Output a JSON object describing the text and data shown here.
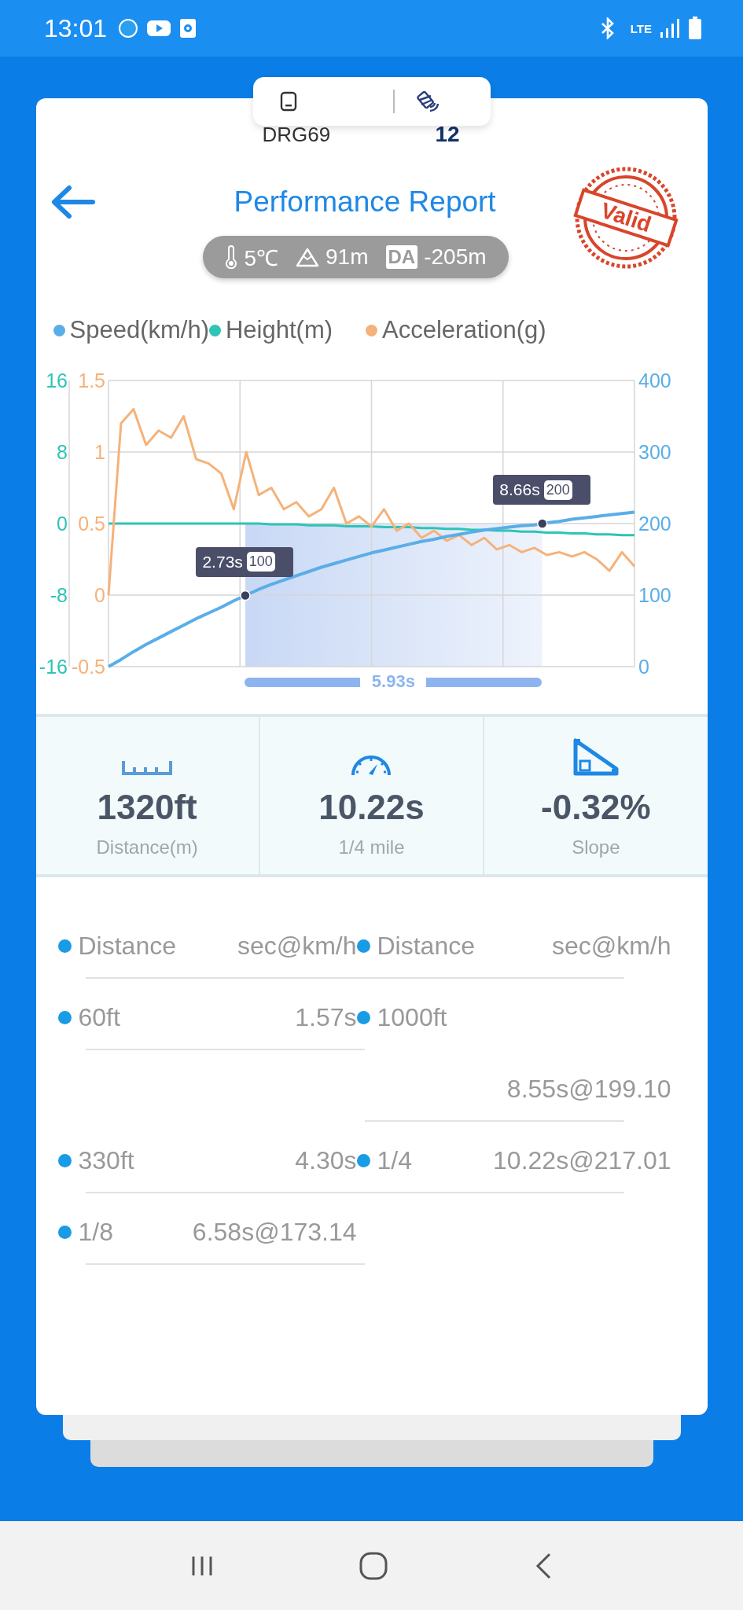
{
  "status_bar": {
    "time": "13:01",
    "network": "LTE"
  },
  "device": {
    "name": "DRG69",
    "satellites": "12"
  },
  "header": {
    "title": "Performance Report",
    "stamp": "Valid"
  },
  "conditions": {
    "temperature": "5℃",
    "altitude": "91m",
    "da_label": "DA",
    "density_altitude": "-205m"
  },
  "chart": {
    "range_label": "5.93s",
    "markers": [
      {
        "time": "2.73s",
        "speed": "100"
      },
      {
        "time": "8.66s",
        "speed": "200"
      }
    ],
    "panels": [
      {
        "chart_data": {
          "type": "line",
          "ylim": [
            0,
            400
          ],
          "yticks": [
            0,
            100,
            200,
            300,
            400
          ],
          "categories": [
            null,
            null,
            null,
            null,
            null,
            null,
            null,
            null,
            null,
            null,
            null,
            null,
            null,
            null,
            null,
            null,
            null,
            null,
            null,
            null,
            null,
            null,
            null,
            null,
            null,
            null,
            null,
            null,
            null,
            null,
            null,
            null,
            null,
            null,
            null,
            null,
            null,
            null,
            null,
            null,
            null,
            null,
            null
          ],
          "series": [
            {
              "name": "Speed(km/h)",
              "color": "#5aaee8",
              "values": [
                0,
                10,
                21,
                31,
                40,
                49,
                58,
                67,
                75,
                83,
                92,
                100,
                108,
                115,
                121,
                127,
                133,
                139,
                144,
                149,
                154,
                159,
                163,
                167,
                171,
                175,
                178,
                182,
                185,
                188,
                191,
                193,
                195,
                197,
                198,
                201,
                203,
                206,
                208,
                210,
                212,
                214,
                216
              ]
            }
          ]
        }
      },
      {
        "chart_data": {
          "type": "line",
          "ylim": [
            -16,
            16
          ],
          "yticks": [
            -16,
            -8,
            0,
            8,
            16
          ],
          "categories": [
            null,
            null,
            null,
            null,
            null,
            null,
            null,
            null,
            null,
            null,
            null,
            null,
            null,
            null,
            null,
            null,
            null,
            null,
            null,
            null,
            null,
            null,
            null,
            null,
            null,
            null,
            null,
            null,
            null,
            null,
            null,
            null,
            null,
            null,
            null,
            null,
            null,
            null,
            null,
            null,
            null,
            null,
            null
          ],
          "series": [
            {
              "name": "Height(m)",
              "color": "#2ec4b6",
              "values": [
                0,
                0,
                0,
                0,
                0,
                0,
                0,
                0,
                0,
                0,
                0,
                0,
                0,
                -0.1,
                -0.1,
                -0.1,
                -0.2,
                -0.2,
                -0.2,
                -0.3,
                -0.3,
                -0.3,
                -0.4,
                -0.4,
                -0.4,
                -0.5,
                -0.5,
                -0.6,
                -0.6,
                -0.7,
                -0.7,
                -0.8,
                -0.8,
                -0.9,
                -0.9,
                -1.0,
                -1.0,
                -1.1,
                -1.1,
                -1.2,
                -1.2,
                -1.3,
                -1.3
              ]
            }
          ]
        }
      },
      {
        "chart_data": {
          "type": "line",
          "ylim": [
            -0.5,
            1.5
          ],
          "yticks": [
            -0.5,
            0,
            0.5,
            1,
            1.5
          ],
          "categories": [
            null,
            null,
            null,
            null,
            null,
            null,
            null,
            null,
            null,
            null,
            null,
            null,
            null,
            null,
            null,
            null,
            null,
            null,
            null,
            null,
            null,
            null,
            null,
            null,
            null,
            null,
            null,
            null,
            null,
            null,
            null,
            null,
            null,
            null,
            null,
            null,
            null,
            null,
            null,
            null,
            null,
            null,
            null
          ],
          "series": [
            {
              "name": "Acceleration(g)",
              "color": "#f5b27a",
              "values": [
                0,
                1.2,
                1.3,
                1.05,
                1.15,
                1.1,
                1.25,
                0.95,
                0.92,
                0.85,
                0.6,
                1.0,
                0.7,
                0.75,
                0.6,
                0.65,
                0.55,
                0.6,
                0.75,
                0.5,
                0.55,
                0.48,
                0.6,
                0.45,
                0.5,
                0.4,
                0.45,
                0.38,
                0.42,
                0.35,
                0.4,
                0.32,
                0.35,
                0.3,
                0.33,
                0.28,
                0.3,
                0.27,
                0.3,
                0.25,
                0.17,
                0.3,
                0.2
              ]
            }
          ]
        }
      }
    ]
  },
  "stats": [
    {
      "kind": "distance",
      "value": "1320ft",
      "label": "Distance(m)"
    },
    {
      "kind": "time",
      "value": "10.22s",
      "label": "1/4 mile"
    },
    {
      "kind": "slope",
      "value": "-0.32%",
      "label": "Slope"
    }
  ],
  "splits": [
    {
      "left": {
        "kind": "inline",
        "label": "Distance",
        "value": "sec@km/h"
      },
      "right": {
        "kind": "inline",
        "label": "Distance",
        "value": "sec@km/h"
      }
    },
    {
      "left": {
        "kind": "inline",
        "label": "60ft",
        "value": "1.57s"
      },
      "right": {
        "kind": "stacked",
        "label": "1000ft",
        "value": "8.55s@199.10"
      }
    },
    {
      "left": {
        "kind": "inline",
        "label": "330ft",
        "value": "4.30s"
      },
      "right": {
        "kind": "inline",
        "label": "1/4",
        "value": "10.22s@217.01"
      }
    },
    {
      "left": {
        "kind": "inline",
        "label": "1/8",
        "value": "6.58s@173.14"
      }
    }
  ]
}
